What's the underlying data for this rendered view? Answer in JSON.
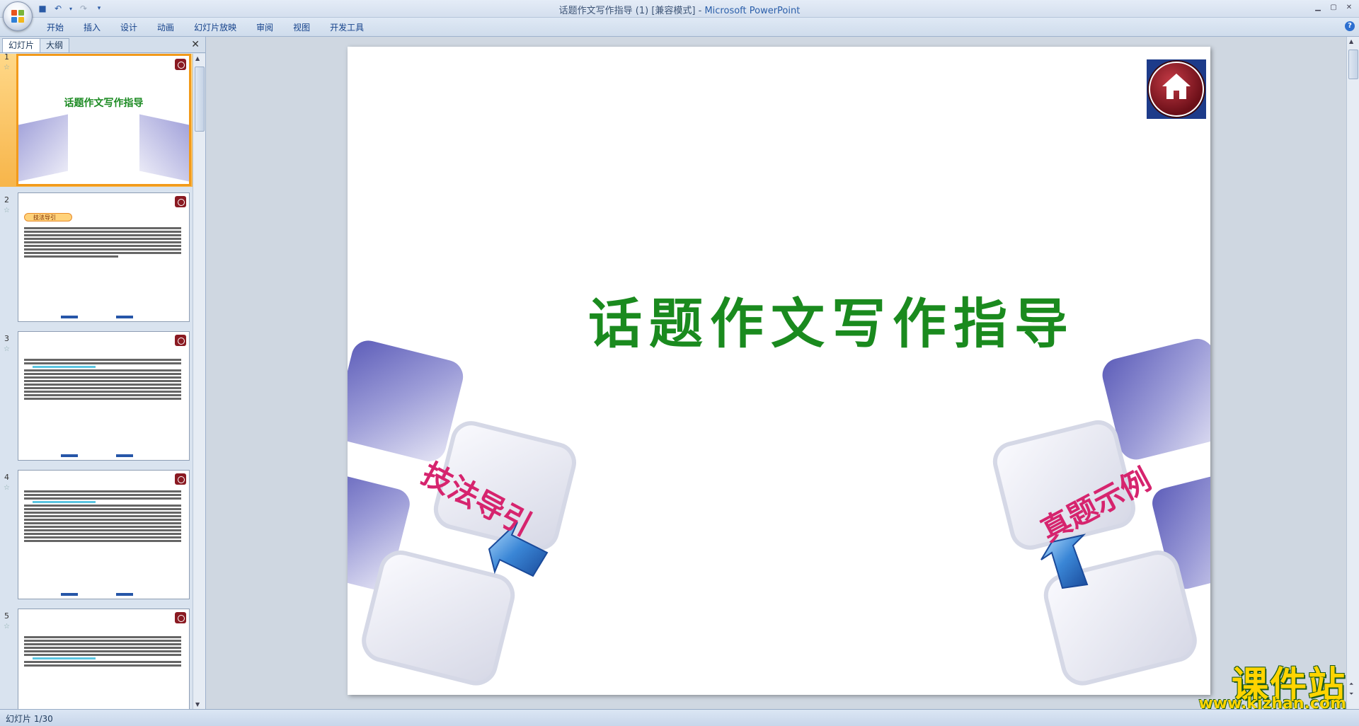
{
  "window": {
    "title": "话题作文写作指导 (1) [兼容模式] - ",
    "app_name": "Microsoft PowerPoint"
  },
  "ribbon": {
    "tabs": [
      "开始",
      "插入",
      "设计",
      "动画",
      "幻灯片放映",
      "审阅",
      "视图",
      "开发工具"
    ]
  },
  "left_pane": {
    "tab_slides": "幻灯片",
    "tab_outline": "大纲",
    "thumbnails": [
      {
        "num": "1",
        "title": "话题作文写作指导"
      },
      {
        "num": "2",
        "label": "技法导引"
      },
      {
        "num": "3"
      },
      {
        "num": "4"
      },
      {
        "num": "5"
      }
    ]
  },
  "slide": {
    "title": "话题作文写作指导",
    "left_text": "技法导引",
    "right_text": "真题示例"
  },
  "status": {
    "slide_indicator": "幻灯片 1/30"
  },
  "watermark": {
    "main": "课件站",
    "url": "www.kjzhan.com"
  },
  "colors": {
    "title_green": "#1a8a1e",
    "pink_text": "#d6246e",
    "accent_orange": "#f29a1a",
    "ribbon_blue": "#15428b"
  }
}
